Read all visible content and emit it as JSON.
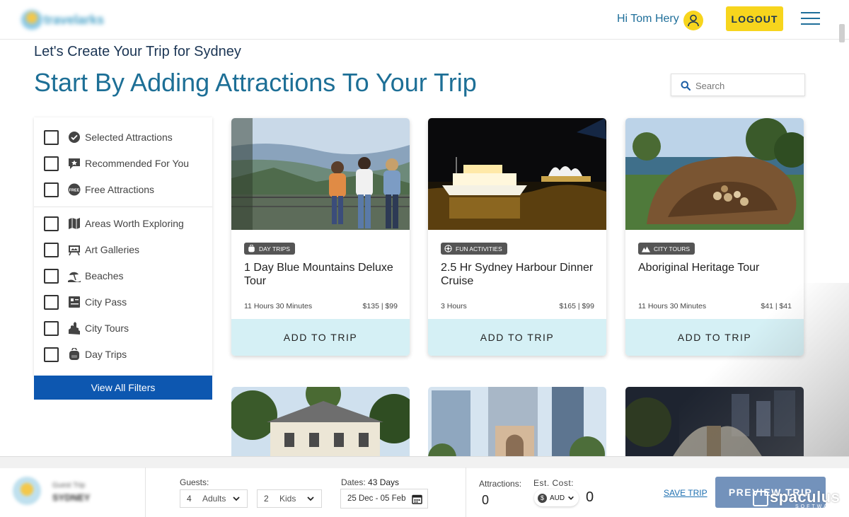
{
  "header": {
    "logo_text": "travelarks",
    "greeting": "Hi Tom Hery",
    "logout_label": "LOGOUT"
  },
  "page": {
    "subtitle": "Let's Create Your Trip for Sydney",
    "title": "Start By Adding Attractions To Your Trip"
  },
  "search": {
    "placeholder": "Search"
  },
  "filters": {
    "items": [
      {
        "label": "Selected Attractions",
        "icon": "check-circle-icon"
      },
      {
        "label": "Recommended For You",
        "icon": "recommend-icon"
      },
      {
        "label": "Free Attractions",
        "icon": "free-badge-icon"
      },
      {
        "label": "Areas Worth Exploring",
        "icon": "map-icon"
      },
      {
        "label": "Art Galleries",
        "icon": "gallery-icon"
      },
      {
        "label": "Beaches",
        "icon": "beach-icon"
      },
      {
        "label": "City Pass",
        "icon": "pass-icon"
      },
      {
        "label": "City Tours",
        "icon": "city-icon"
      },
      {
        "label": "Day Trips",
        "icon": "backpack-icon"
      }
    ],
    "view_all_label": "View All Filters"
  },
  "cards": [
    {
      "tag": "DAY TRIPS",
      "title": "1 Day Blue Mountains Deluxe Tour",
      "duration": "11 Hours 30 Minutes",
      "price": "$135 | $99",
      "add_label": "ADD TO TRIP"
    },
    {
      "tag": "FUN ACTIVITIES",
      "title": "2.5 Hr Sydney Harbour Dinner Cruise",
      "duration": "3 Hours",
      "price": "$165 | $99",
      "add_label": "ADD TO TRIP"
    },
    {
      "tag": "CITY TOURS",
      "title": "Aboriginal Heritage Tour",
      "duration": "11 Hours 30 Minutes",
      "price": "$41 | $41",
      "add_label": "ADD TO TRIP"
    }
  ],
  "bottom_bar": {
    "trip_name": "Guest Trip",
    "trip_city": "SYDNEY",
    "guests_label": "Guests:",
    "adults_value": "4",
    "adults_label": "Adults",
    "kids_value": "2",
    "kids_label": "Kids",
    "dates_label": "Dates:",
    "dates_days": "43 Days",
    "dates_range": "25 Dec - 05 Feb",
    "attractions_label": "Attractions:",
    "attractions_count": "0",
    "est_cost_label": "Est. Cost:",
    "currency": "AUD",
    "est_cost_value": "0",
    "save_trip_label": "SAVE TRIP",
    "preview_trip_label": "PREVIEW TRIP"
  },
  "watermark": {
    "name": "spaculus",
    "sub": "SOFTWARE"
  },
  "colors": {
    "brand_blue": "#1d6f96",
    "accent_yellow": "#f7d51d",
    "filter_button": "#0d57b0",
    "add_to_trip_bg": "#d5f0f5"
  }
}
